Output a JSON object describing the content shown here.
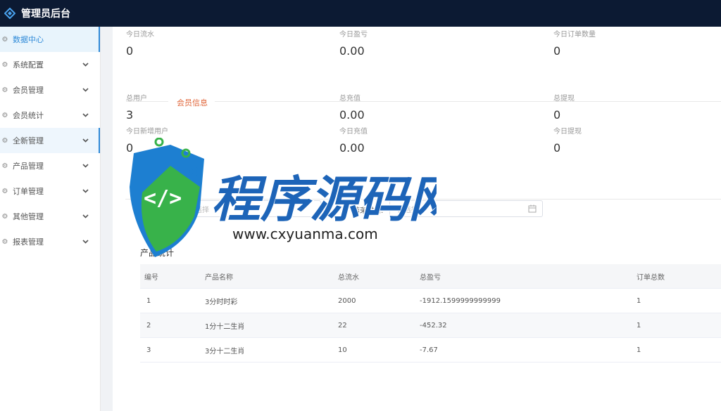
{
  "app": {
    "title": "管理员后台"
  },
  "sidebar": {
    "items": [
      {
        "label": "数据中心",
        "has_chevron": false
      },
      {
        "label": "系统配置",
        "has_chevron": true
      },
      {
        "label": "会员管理",
        "has_chevron": true
      },
      {
        "label": "会员统计",
        "has_chevron": true
      },
      {
        "label": "全新管理",
        "has_chevron": true
      },
      {
        "label": "产品管理",
        "has_chevron": true
      },
      {
        "label": "订单管理",
        "has_chevron": true
      },
      {
        "label": "其他管理",
        "has_chevron": true
      },
      {
        "label": "报表管理",
        "has_chevron": true
      }
    ]
  },
  "today": {
    "flow_label": "今日流水",
    "flow_value": "0",
    "profit_label": "今日盈亏",
    "profit_value": "0.00",
    "orders_label": "今日订单数量",
    "orders_value": "0"
  },
  "member_section": {
    "title": "会员信息"
  },
  "members": {
    "total_users_label": "总用户",
    "total_users_value": "3",
    "total_recharge_label": "总充值",
    "total_recharge_value": "0.00",
    "total_withdraw_label": "总提现",
    "total_withdraw_value": "0",
    "new_users_label": "今日新增用户",
    "new_users_value": "0",
    "today_recharge_label": "今日充值",
    "today_recharge_value": "0.00",
    "today_withdraw_label": "今日提现",
    "today_withdraw_value": "0"
  },
  "filters": {
    "start_placeholder": "请选择",
    "end_label": "结束时间:",
    "end_placeholder": "请选择"
  },
  "products": {
    "title": "产品统计",
    "columns": [
      "编号",
      "产品名称",
      "总流水",
      "总盈亏",
      "订单总数"
    ],
    "rows": [
      [
        "1",
        "3分时时彩",
        "2000",
        "-1912.1599999999999",
        "1"
      ],
      [
        "2",
        "1分十二生肖",
        "22",
        "-452.32",
        "1"
      ],
      [
        "3",
        "3分十二生肖",
        "10",
        "-7.67",
        "1"
      ]
    ]
  },
  "watermark": {
    "text_cn": "程序源码网",
    "text_url": "www.cxyuanma.com"
  },
  "colors": {
    "topbar": "#0c1a33",
    "accent": "#2f8ad8",
    "section_title": "#e0663a"
  }
}
